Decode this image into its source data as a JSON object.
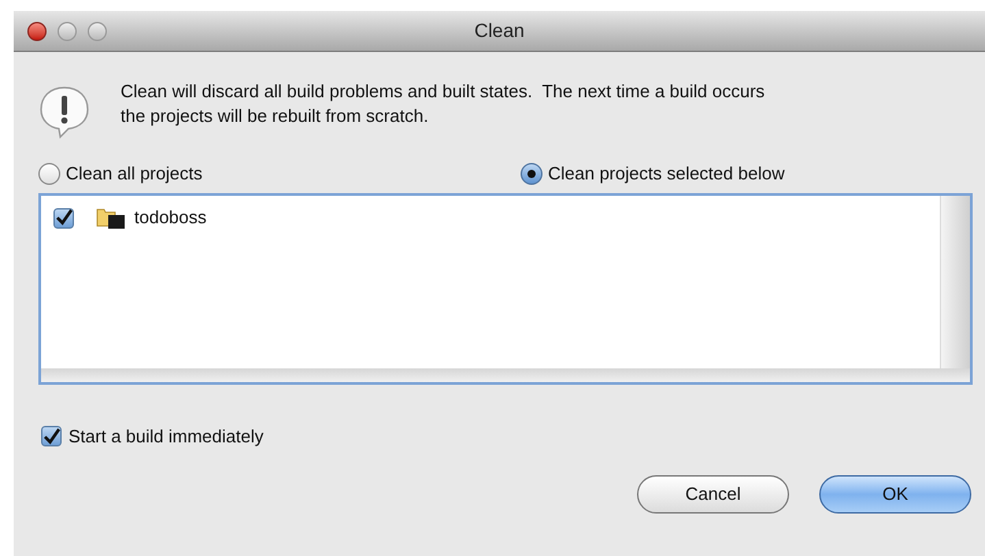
{
  "window": {
    "title": "Clean"
  },
  "message_lines": [
    "Clean will discard all build problems and built states.  The next time a build occurs",
    "the projects will be rebuilt from scratch."
  ],
  "scope_options": [
    {
      "label": "Clean all projects",
      "selected": false
    },
    {
      "label": "Clean projects selected below",
      "selected": true
    }
  ],
  "projects": [
    {
      "name": "todoboss",
      "checked": true
    }
  ],
  "start_build": {
    "label": "Start a build immediately",
    "checked": true
  },
  "buttons": [
    {
      "label": "Cancel",
      "kind": "secondary"
    },
    {
      "label": "OK",
      "kind": "primary"
    }
  ]
}
